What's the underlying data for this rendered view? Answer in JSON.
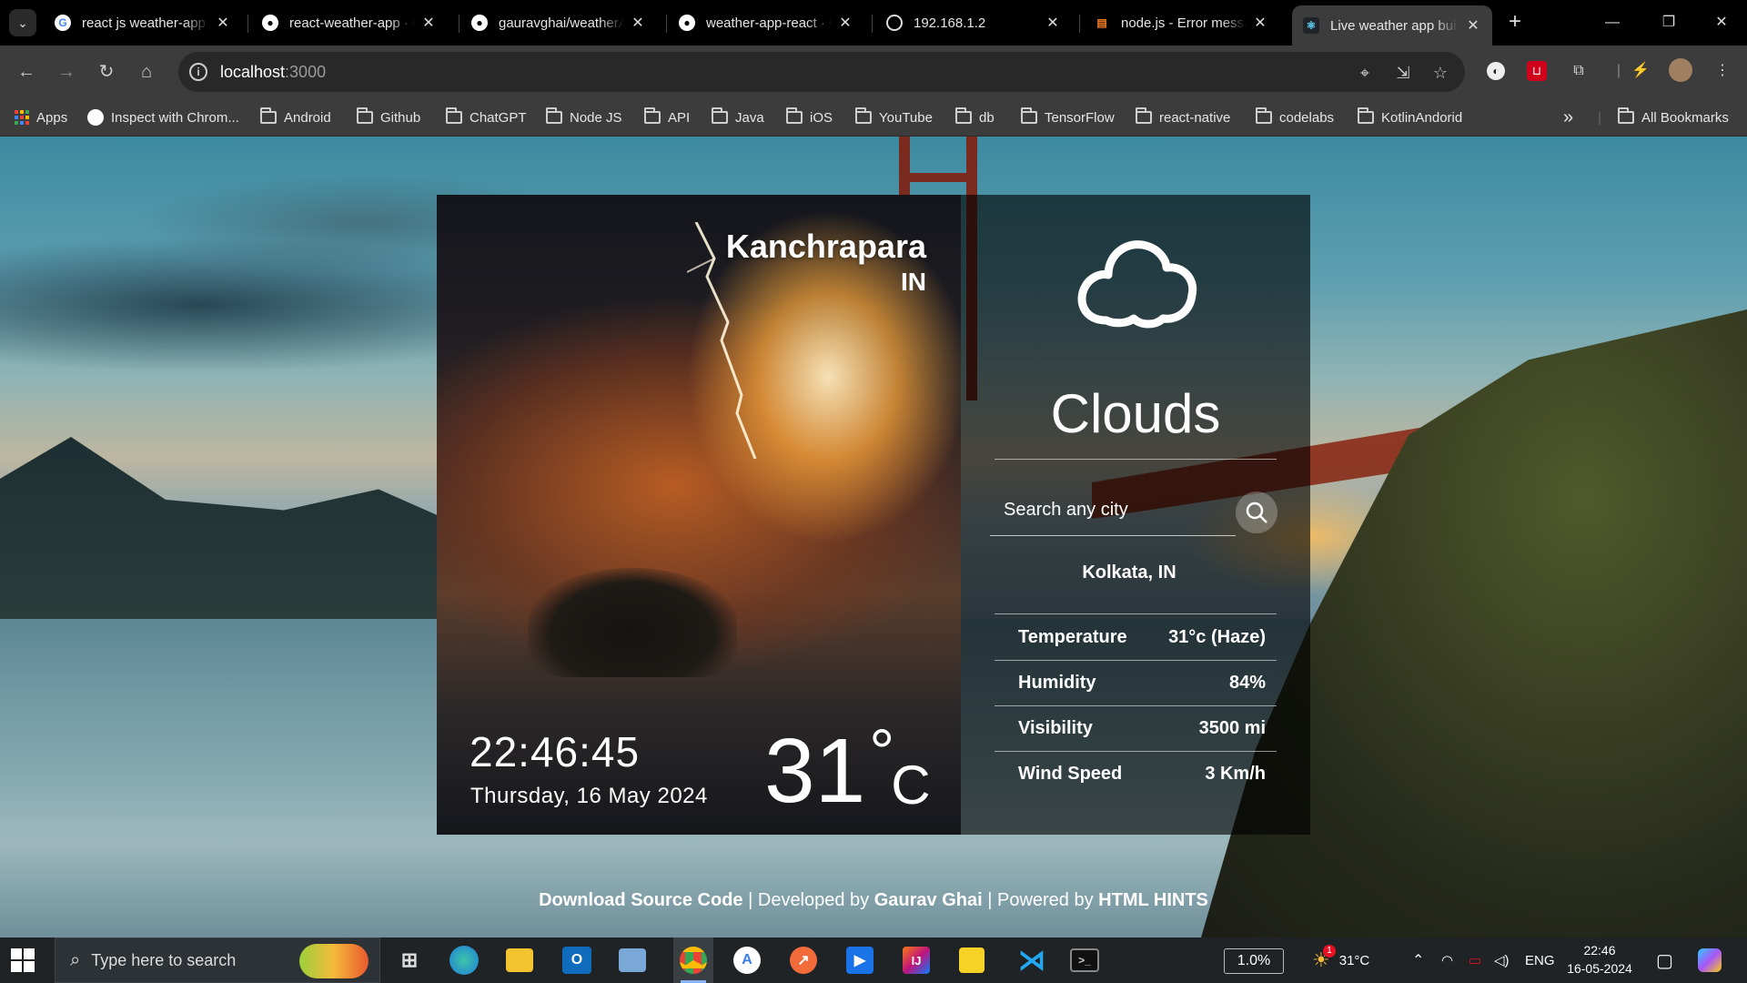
{
  "browser": {
    "tabs": [
      {
        "label": "react js weather-app",
        "favicon": "google-icon"
      },
      {
        "label": "react-weather-app · G",
        "favicon": "github-icon"
      },
      {
        "label": "gauravghai/weatherA",
        "favicon": "github-icon"
      },
      {
        "label": "weather-app-react · G",
        "favicon": "github-icon"
      },
      {
        "label": "192.168.1.2",
        "favicon": "globe-icon"
      },
      {
        "label": "node.js - Error messa",
        "favicon": "stackoverflow-icon"
      },
      {
        "label": "Live weather app bui",
        "favicon": "react-icon",
        "active": true
      }
    ],
    "url_host": "localhost",
    "url_port": ":3000",
    "bookmarks": {
      "apps": "Apps",
      "inspect": "Inspect with Chrom...",
      "folders": [
        "Android",
        "Github",
        "ChatGPT",
        "Node JS",
        "API",
        "Java",
        "iOS",
        "YouTube",
        "db",
        "TensorFlow",
        "react-native",
        "codelabs",
        "KotlinAndorid"
      ],
      "overflow": "»",
      "all": "All Bookmarks"
    }
  },
  "weather": {
    "city": "Kanchrapara",
    "country": "IN",
    "time": "22:46:45",
    "date": "Thursday, 16 May 2024",
    "temp_value": "31",
    "temp_degree": "°",
    "temp_unit": "C",
    "condition": "Clouds",
    "search_placeholder": "Search any city",
    "location": "Kolkata, IN",
    "details": [
      {
        "label": "Temperature",
        "value": "31°c (Haze)"
      },
      {
        "label": "Humidity",
        "value": "84%"
      },
      {
        "label": "Visibility",
        "value": "3500 mi"
      },
      {
        "label": "Wind Speed",
        "value": "3 Km/h"
      }
    ]
  },
  "footer": {
    "download": "Download Source Code",
    "sep1": " | Developed by ",
    "author": "Gaurav Ghai",
    "sep2": " | Powered by ",
    "powered": "HTML HINTS"
  },
  "taskbar": {
    "search_placeholder": "Type here to search",
    "cpu": "1.0%",
    "weather_temp": "31°C",
    "lang": "ENG",
    "clock_time": "22:46",
    "clock_date": "16-05-2024",
    "notification_badge": "1"
  },
  "colors": {
    "active_tab": "#3c3c3c",
    "toolbar": "#3c3c3c",
    "panel_overlay": "rgba(0,0,0,0.62)",
    "taskbar": "#1f2326"
  }
}
